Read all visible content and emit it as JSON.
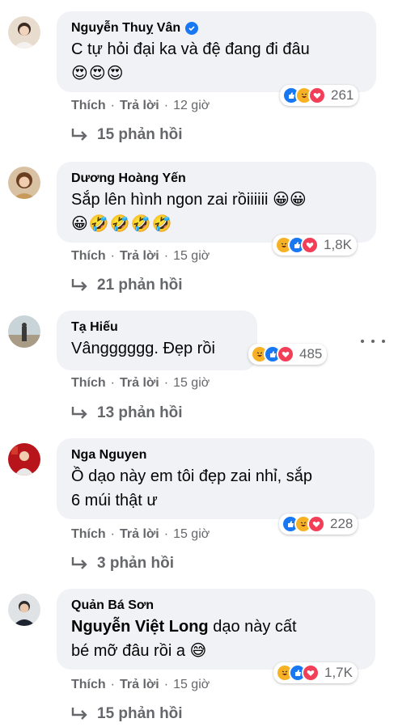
{
  "colors": {
    "bubble_bg": "#f0f2f5",
    "meta_text": "#65676b",
    "like_blue": "#1877f2",
    "haha_yellow": "#f7b125",
    "love_red": "#f33e58"
  },
  "actions": {
    "like": "Thích",
    "reply": "Trả lời",
    "dot": "·"
  },
  "comments": [
    {
      "author": "Nguyễn Thuỵ Vân",
      "verified": true,
      "text": "C tự hỏi đại ka và đệ đang đi đâu",
      "emojis": "😍😍😍",
      "reactions": [
        "like-icon",
        "haha-icon",
        "love-icon"
      ],
      "reaction_count": "261",
      "time": "12 giờ",
      "replies": "15 phản hồi"
    },
    {
      "author": "Dương Hoàng Yến",
      "text": "Sắp lên hình ngon zai rồiiiiii 😀😀",
      "emojis": "😀🤣🤣🤣🤣",
      "reactions": [
        "haha-icon",
        "like-icon",
        "love-icon"
      ],
      "reaction_count": "1,8K",
      "time": "15 giờ",
      "replies": "21 phản hồi"
    },
    {
      "author": "Tạ Hiếu",
      "text": "Vângggggg. Đẹp rồi",
      "reactions": [
        "haha-icon",
        "like-icon",
        "love-icon"
      ],
      "reaction_count": "485",
      "time": "15 giờ",
      "replies": "13 phản hồi"
    },
    {
      "author": "Nga Nguyen",
      "text_line1": "Ồ dạo này em tôi đẹp zai nhỉ, sắp",
      "text_line2": "6 múi thật ư",
      "reactions": [
        "like-icon",
        "haha-icon",
        "love-icon"
      ],
      "reaction_count": "228",
      "time": "15 giờ",
      "replies": "3 phản hồi"
    },
    {
      "author": "Quản Bá Sơn",
      "mention": "Nguyễn Việt Long",
      "text_line1_rest": " dạo này cất",
      "text_line2": "bé mỡ đâu rồi a 😅",
      "reactions": [
        "haha-icon",
        "like-icon",
        "love-icon"
      ],
      "reaction_count": "1,7K",
      "time": "15 giờ",
      "replies": "15 phản hồi"
    }
  ]
}
